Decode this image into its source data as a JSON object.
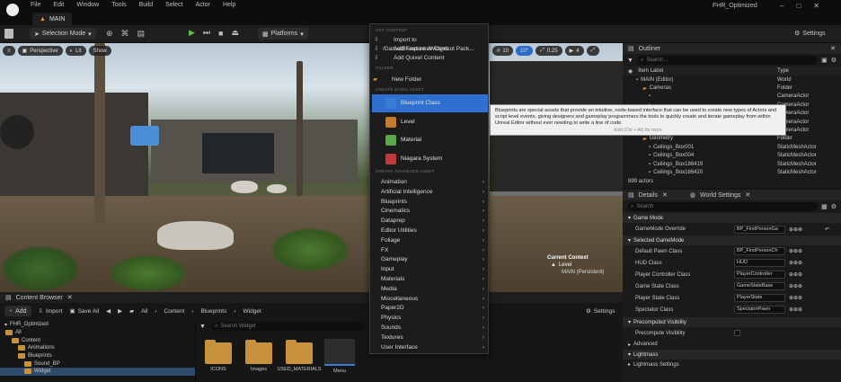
{
  "window": {
    "menu": [
      "File",
      "Edit",
      "Window",
      "Tools",
      "Build",
      "Select",
      "Actor",
      "Help"
    ],
    "project_name": "FHR_Optimized",
    "level_tab": "MAIN"
  },
  "toolbar": {
    "selection_mode": "Selection Mode",
    "platforms": "Platforms",
    "settings": "Settings"
  },
  "viewport": {
    "perspective": "Perspective",
    "lit": "Lit",
    "show": "Show",
    "grid_size": "10",
    "angle": "10°",
    "scale": "0.25",
    "camera_speed": "4",
    "current_context": "Current Context",
    "level": "Level",
    "persistent": "MAIN (Persistent)"
  },
  "outliner": {
    "title": "Outliner",
    "search_placeholder": "Search...",
    "col_label": "Item Label",
    "col_type": "Type",
    "rows": [
      {
        "label": "MAIN (Editor)",
        "type": "World",
        "indent": 1
      },
      {
        "label": "Cameras",
        "type": "Folder",
        "indent": 2
      },
      {
        "label": "",
        "type": "CameraActor",
        "indent": 3
      },
      {
        "label": "",
        "type": "CameraActor",
        "indent": 3
      },
      {
        "label": "",
        "type": "CameraActor",
        "indent": 3
      },
      {
        "label": "",
        "type": "CameraActor",
        "indent": 3
      },
      {
        "label": "",
        "type": "CameraActor",
        "indent": 3
      },
      {
        "label": "Geometry",
        "type": "Folder",
        "indent": 2
      },
      {
        "label": "Ceilings_Box001",
        "type": "StaticMeshActor",
        "indent": 3
      },
      {
        "label": "Ceilings_Box004",
        "type": "StaticMeshActor",
        "indent": 3
      },
      {
        "label": "Ceilings_Box186419",
        "type": "StaticMeshActor",
        "indent": 3
      },
      {
        "label": "Ceilings_Box186420",
        "type": "StaticMeshActor",
        "indent": 3
      }
    ],
    "actor_count": "899 actors"
  },
  "details": {
    "tab_details": "Details",
    "tab_world": "World Settings",
    "search_placeholder": "Search",
    "game_mode_section": "Game Mode",
    "gamemode_override_label": "GameMode Override",
    "gamemode_override_value": "BP_FirstPersonGa",
    "selected_gamemode_section": "Selected GameMode",
    "props": [
      {
        "label": "Default Pawn Class",
        "value": "BP_FirstPersonCh"
      },
      {
        "label": "HUD Class",
        "value": "HUD"
      },
      {
        "label": "Player Controller Class",
        "value": "PlayerController"
      },
      {
        "label": "Game State Class",
        "value": "GameStateBase"
      },
      {
        "label": "Player State Class",
        "value": "PlayerState"
      },
      {
        "label": "Spectator Class",
        "value": "SpectatorPawn"
      }
    ],
    "precomputed_section": "Precomputed Visibility",
    "precompute_label": "Precompute Visibility",
    "advanced": "Advanced",
    "lightmass_section": "Lightmass",
    "lightmass_settings": "Lightmass Settings"
  },
  "content_browser": {
    "title": "Content Browser",
    "add": "Add",
    "import": "Import",
    "save_all": "Save All",
    "breadcrumb": [
      "All",
      "Content",
      "Blueprints",
      "Widget"
    ],
    "settings": "Settings",
    "project": "FHR_Optimized",
    "search_placeholder": "Search Widget",
    "tree": [
      {
        "label": "All",
        "indent": 0
      },
      {
        "label": "Content",
        "indent": 1
      },
      {
        "label": "Animations",
        "indent": 2
      },
      {
        "label": "Blueprints",
        "indent": 2
      },
      {
        "label": "Sound_BP",
        "indent": 3
      },
      {
        "label": "Widget",
        "indent": 3
      }
    ],
    "assets": [
      "ICONS",
      "Images",
      "USED_MATERIALS",
      "Menu"
    ]
  },
  "context_menu": {
    "get_content_header": "GET CONTENT",
    "get_content": [
      "Import to /Game/Blueprints/Widget...",
      "Add Feature or Content Pack...",
      "Add Quixel Content"
    ],
    "folder_header": "FOLDER",
    "new_folder": "New Folder",
    "basic_header": "CREATE BASIC ASSET",
    "basic": [
      {
        "label": "Blueprint Class",
        "color": "#3a7bd5"
      },
      {
        "label": "Level",
        "color": "#c47a2b"
      },
      {
        "label": "Material",
        "color": "#5aa84a"
      },
      {
        "label": "Niagara System",
        "color": "#c23b3b"
      }
    ],
    "advanced_header": "CREATE ADVANCED ASSET",
    "advanced": [
      "Animation",
      "Artificial Intelligence",
      "Blueprints",
      "Cinematics",
      "Dataprep",
      "Editor Utilities",
      "Foliage",
      "FX",
      "Gameplay",
      "Input",
      "Materials",
      "Media",
      "Miscellaneous",
      "Paper2D",
      "Physics",
      "Sounds",
      "Textures",
      "User Interface"
    ]
  },
  "tooltip": {
    "text": "Blueprints are special assets that provide an intuitive, node-based interface that can be used to create new types of Actors and script level events, giving designers and gameplay programmers the tools to quickly create and iterate gameplay from within Unreal Editor without ever needing to write a line of code.",
    "hint": "hold (Ctrl + Alt) for more"
  }
}
